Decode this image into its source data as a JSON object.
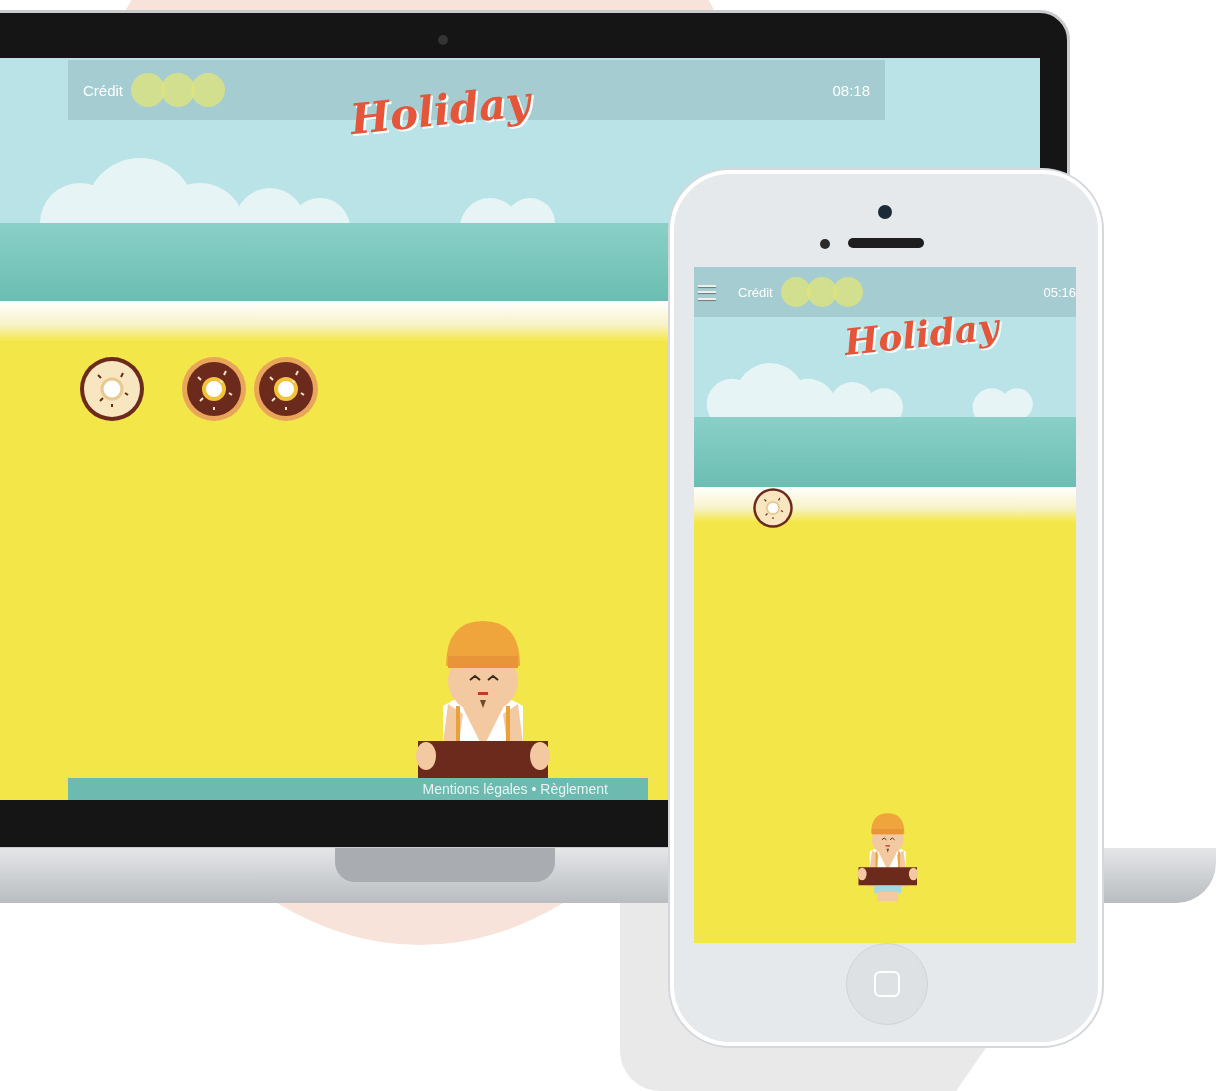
{
  "laptop": {
    "header": {
      "credit_label": "Crédit",
      "time": "08:18"
    },
    "logo": "Holiday",
    "footer": "Mentions légales • Règlement"
  },
  "phone": {
    "header": {
      "credit_label": "Crédit",
      "time": "05:16"
    },
    "logo": "Holiday"
  }
}
